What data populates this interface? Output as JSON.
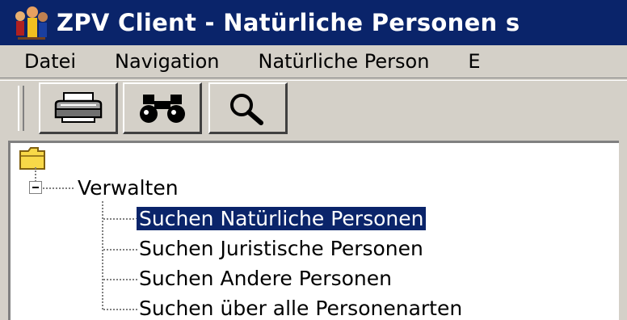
{
  "window": {
    "title": "ZPV Client - Natürliche Personen s"
  },
  "menu": {
    "items": [
      {
        "label": "Datei"
      },
      {
        "label": "Navigation"
      },
      {
        "label": "Natürliche Person"
      },
      {
        "label": "E"
      }
    ]
  },
  "toolbar": {
    "buttons": [
      {
        "icon": "printer-icon"
      },
      {
        "icon": "binoculars-icon"
      },
      {
        "icon": "magnifier-icon"
      }
    ]
  },
  "tree": {
    "root_icon": "folder-icon",
    "group": {
      "label": "Verwalten",
      "expanded": true,
      "children": [
        {
          "label": "Suchen Natürliche Personen",
          "selected": true
        },
        {
          "label": "Suchen Juristische Personen",
          "selected": false
        },
        {
          "label": "Suchen Andere Personen",
          "selected": false
        },
        {
          "label": "Suchen über alle Personenarten",
          "selected": false
        }
      ]
    }
  },
  "colors": {
    "titlebar": "#0a246a",
    "selection": "#0a246a",
    "face": "#d4d0c8"
  }
}
